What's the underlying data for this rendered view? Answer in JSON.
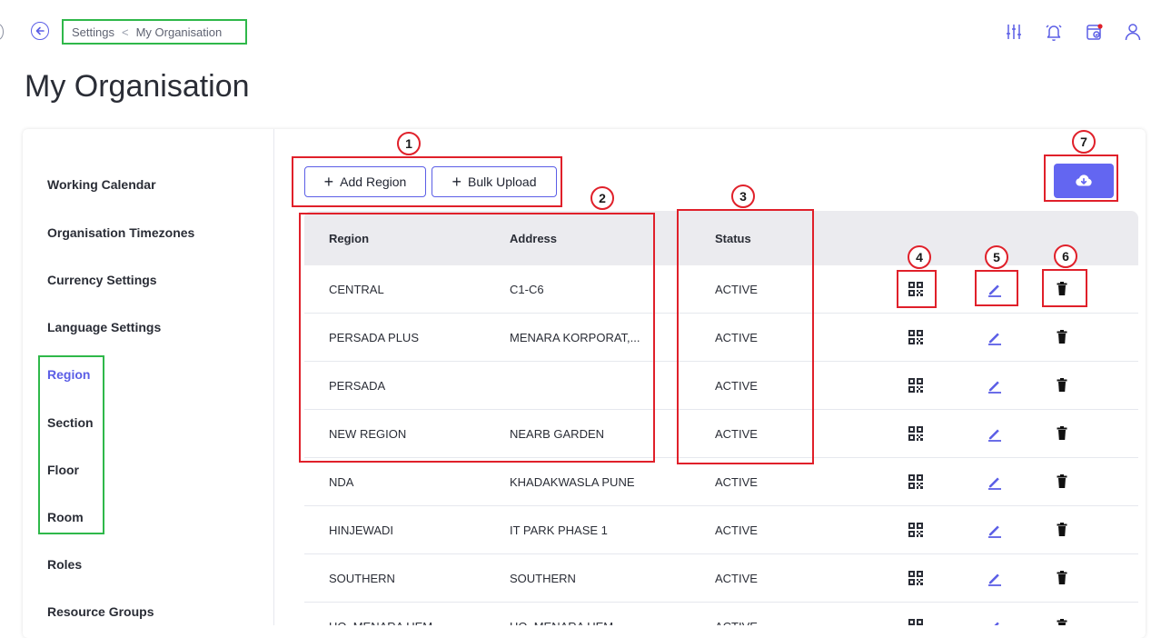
{
  "breadcrumb": {
    "parent": "Settings",
    "separator": "<",
    "current": "My Organisation"
  },
  "page": {
    "title": "My Organisation"
  },
  "sidebar": {
    "items": [
      {
        "label": "Working Calendar"
      },
      {
        "label": "Organisation Timezones"
      },
      {
        "label": "Currency Settings"
      },
      {
        "label": "Language Settings"
      },
      {
        "label": "Region",
        "active": true
      },
      {
        "label": "Section"
      },
      {
        "label": "Floor"
      },
      {
        "label": "Room"
      },
      {
        "label": "Roles"
      },
      {
        "label": "Resource Groups"
      }
    ]
  },
  "toolbar": {
    "add_label": "Add Region",
    "bulk_label": "Bulk Upload"
  },
  "table": {
    "columns": [
      "Region",
      "Address",
      "Status"
    ],
    "rows": [
      {
        "region": "CENTRAL",
        "address": "C1-C6",
        "status": "ACTIVE"
      },
      {
        "region": "PERSADA PLUS",
        "address": "MENARA KORPORAT,...",
        "status": "ACTIVE"
      },
      {
        "region": "PERSADA",
        "address": "",
        "status": "ACTIVE"
      },
      {
        "region": "NEW REGION",
        "address": "NEARB GARDEN",
        "status": "ACTIVE"
      },
      {
        "region": "NDA",
        "address": "KHADAKWASLA PUNE",
        "status": "ACTIVE"
      },
      {
        "region": "HINJEWADI",
        "address": "IT PARK PHASE 1",
        "status": "ACTIVE"
      },
      {
        "region": "SOUTHERN",
        "address": "SOUTHERN",
        "status": "ACTIVE"
      },
      {
        "region": "HQ, MENARA UEM",
        "address": "HQ, MENARA UEM",
        "status": "ACTIVE"
      }
    ]
  },
  "annotations": {
    "b1": "1",
    "b2": "2",
    "b3": "3",
    "b4": "4",
    "b5": "5",
    "b6": "6",
    "b7": "7"
  },
  "colors": {
    "accent": "#6366f1",
    "annotation_red": "#e0202a",
    "annotation_green": "#2fb84a"
  },
  "icons": [
    "back-arrow-icon",
    "filter-sliders-icon",
    "bell-icon",
    "calendar-check-icon",
    "user-icon",
    "qr-code-icon",
    "pencil-icon",
    "trash-icon",
    "cloud-download-icon",
    "plus-icon"
  ]
}
